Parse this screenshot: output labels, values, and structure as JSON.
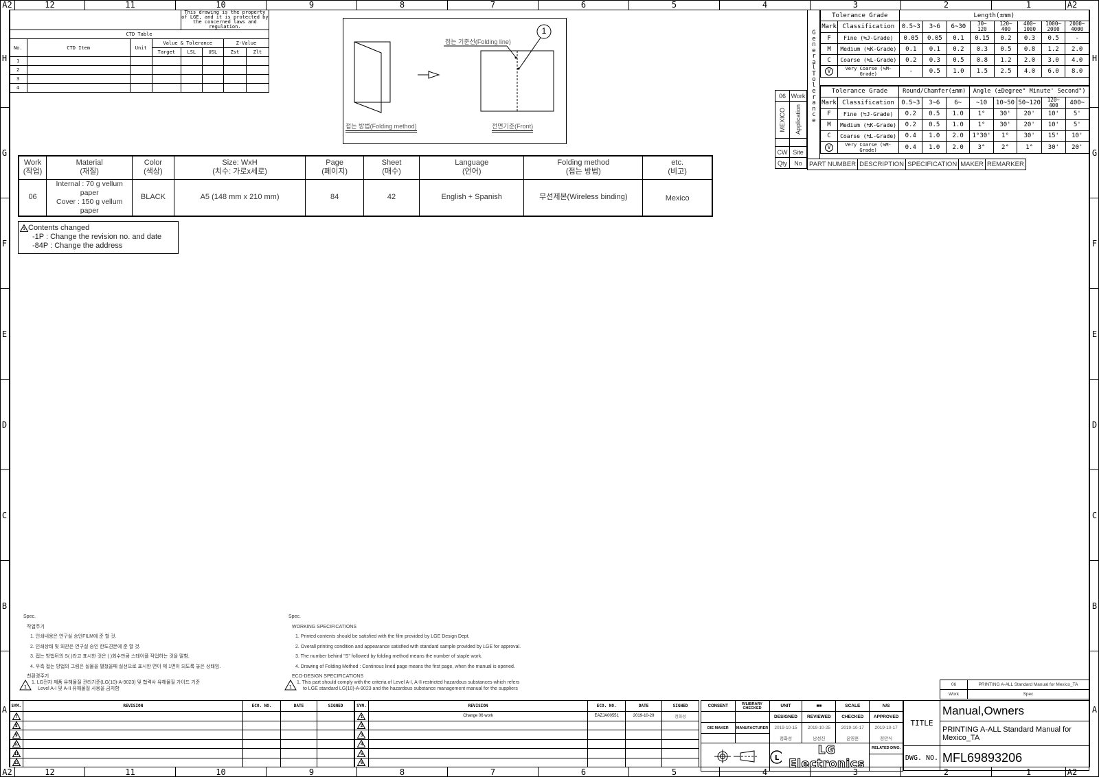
{
  "border": {
    "corner_label": "A2",
    "columns": [
      "12",
      "11",
      "10",
      "9",
      "8",
      "7",
      "6",
      "5",
      "4",
      "3",
      "2",
      "1"
    ],
    "rows": [
      "H",
      "G",
      "F",
      "E",
      "D",
      "C",
      "B",
      "A"
    ]
  },
  "ctd_table": {
    "notice": "This drawing is the property of LGE, and it is protected by the concerned laws and regulation.",
    "title": "CTD Table",
    "headers": {
      "no": "No.",
      "item": "CTD Item",
      "unit": "Unit",
      "value_tolerance": "Value & Tolerance",
      "target": "Target",
      "lsl": "LSL",
      "usl": "USL",
      "z_value": "Z-Value",
      "zst": "Zst",
      "zlt": "Zlt"
    },
    "rows": [
      "1",
      "2",
      "3",
      "4"
    ]
  },
  "folding_diagram": {
    "folding_line_label": "접는 기준선(Folding line)",
    "callout_number": "1",
    "folding_method_caption": "접는 방법(Folding method)",
    "front_caption": "전면기준(Front)"
  },
  "spec_table": {
    "headers": [
      {
        "en": "Work",
        "ko": "(작업)"
      },
      {
        "en": "Material",
        "ko": "(재질)"
      },
      {
        "en": "Color",
        "ko": "(색상)"
      },
      {
        "en": "Size: WxH",
        "ko": "(치수: 가로x세로)"
      },
      {
        "en": "Page",
        "ko": "(페이지)"
      },
      {
        "en": "Sheet",
        "ko": "(매수)"
      },
      {
        "en": "Language",
        "ko": "(언어)"
      },
      {
        "en": "Folding method",
        "ko": "(접는 방법)"
      },
      {
        "en": "etc.",
        "ko": "(비고)"
      }
    ],
    "row": {
      "work": "06",
      "material_line1": "Internal : 70 g vellum paper",
      "material_line2": "Cover : 150 g vellum paper",
      "color": "BLACK",
      "size": "A5 (148 mm x 210 mm)",
      "page": "84",
      "sheet": "42",
      "language": "English + Spanish",
      "folding_method": "무선제본(Wireless binding)",
      "etc": "Mexico"
    }
  },
  "change_note": {
    "revision_symbol": "1",
    "title": "Contents changed",
    "lines": [
      "-1P : Change the revision no. and date",
      "-84P : Change the address"
    ]
  },
  "tolerance": {
    "side_label": "General Tolerance",
    "length_table": {
      "grade_header": "Tolerance Grade",
      "group_header": "Length(±mm)",
      "mark_header": "Mark",
      "class_header": "Classification",
      "ranges": [
        "0.5~3",
        "3~6",
        "6~30",
        "30~ 120",
        "120~ 400",
        "400~ 1000",
        "1000~ 2000",
        "2000~ 4000"
      ],
      "rows": [
        {
          "mark": "F",
          "class": "Fine (≒J-Grade)",
          "values": [
            "0.05",
            "0.05",
            "0.1",
            "0.15",
            "0.2",
            "0.3",
            "0.5",
            "-"
          ]
        },
        {
          "mark": "M",
          "class": "Medium (≒K-Grade)",
          "values": [
            "0.1",
            "0.1",
            "0.2",
            "0.3",
            "0.5",
            "0.8",
            "1.2",
            "2.0"
          ]
        },
        {
          "mark": "C",
          "class": "Coarse (≒L-Grade)",
          "values": [
            "0.2",
            "0.3",
            "0.5",
            "0.8",
            "1.2",
            "2.0",
            "3.0",
            "4.0"
          ]
        },
        {
          "mark": "V",
          "class": "Very Coarse (≒M-Grade)",
          "values": [
            "-",
            "0.5",
            "1.0",
            "1.5",
            "2.5",
            "4.0",
            "6.0",
            "8.0"
          ]
        }
      ]
    },
    "angle_table": {
      "grade_header": "Tolerance Grade",
      "round_header": "Round/Chamfer(±mm)",
      "angle_header": "Angle (±Degree° Minute' Second\")",
      "mark_header": "Mark",
      "class_header": "Classification",
      "ranges": [
        "0.5~3",
        "3~6",
        "6~",
        "~10",
        "10~50",
        "50~120",
        "120~ 400",
        "400~"
      ],
      "rows": [
        {
          "mark": "F",
          "class": "Fine (≒J-Grade)",
          "values": [
            "0.2",
            "0.5",
            "1.0",
            "1°",
            "30'",
            "20'",
            "10'",
            "5'"
          ]
        },
        {
          "mark": "M",
          "class": "Medium (≒K-Grade)",
          "values": [
            "0.2",
            "0.5",
            "1.0",
            "1°",
            "30'",
            "20'",
            "10'",
            "5'"
          ]
        },
        {
          "mark": "C",
          "class": "Coarse (≒L-Grade)",
          "values": [
            "0.4",
            "1.0",
            "2.0",
            "1°30'",
            "1°",
            "30'",
            "15'",
            "10'"
          ]
        },
        {
          "mark": "V",
          "class": "Very Coarse (≒M-Grade)",
          "values": [
            "0.4",
            "1.0",
            "2.0",
            "3°",
            "2°",
            "1°",
            "30'",
            "20'"
          ]
        }
      ]
    }
  },
  "application_block": {
    "work_value": "06",
    "work_label": "Work",
    "site_value": "MEXICO",
    "site_application": "Application",
    "cw_label": "CW",
    "site_label": "Site",
    "qty_label": "Qty",
    "no_label": "No",
    "part_number": "PART NUMBER",
    "description": "DESCRIPTION",
    "specification": "SPECIFICATION",
    "maker": "MAKER",
    "remarker": "REMARKER"
  },
  "notes_ko": {
    "spec": "Spec.",
    "heading": "작업주기",
    "items": [
      "1. 인쇄내용은 연구실 승인FILM에 준 할 것.",
      "2. 인쇄상태 및 외관은 연구실 승인 한도견본에 준 할 것.",
      "3. 접는 방법뒤의 S( )라고 표시한 것은 ( )회수만큼 스테이플 작업하는 것을 말함.",
      "4. 우측 접는 방법의 그림은 실물을 펼쳤을때 실선으로 표시한 면이 제 1면이 되도록  놓은 상태임."
    ],
    "eco_heading": "친환경주기",
    "eco_line1": "1. LG전자 제품 유해물질 관리기준(LG(10)-A-9023) 및 협력사 유해물질 가이드 기준",
    "eco_line2": "Level A-I 및 A-II 유해물질 사용을 금지함"
  },
  "notes_en": {
    "spec": "Spec.",
    "heading": "WORKING SPECIFICATIONS",
    "items": [
      "1. Printed contents should be satisfied with the film provided by LGE Design Dept.",
      "2. Overall printing condition and appearance satisfied with standard sample provided by LGE for approval.",
      "3. The number behind \"S\" followed by folding method means the number of staple work.",
      "4. Drawing of Folding Method : Continous lined page means the first page, when the manual is opened."
    ],
    "eco_heading": "ECO-DESIGN SPECIFICATIONS",
    "eco_line1": "1. This part should comply with the criteria of Level A-I, A-II restricted hazardous substances which refers",
    "eco_line2": "to LGE standard LG(10)-A-9023 and the hazardous substance management manual for the suppliers"
  },
  "revision_left": {
    "headers": {
      "sym": "SYM.",
      "revision": "REVISION",
      "eco": "ECO. NO.",
      "date": "DATE",
      "signed": "SIGNED"
    },
    "rows": [
      {
        "sym": "7",
        "revision": "",
        "eco": "",
        "date": "",
        "signed": ""
      },
      {
        "sym": "8",
        "revision": "",
        "eco": "",
        "date": "",
        "signed": ""
      },
      {
        "sym": "9",
        "revision": "",
        "eco": "",
        "date": "",
        "signed": ""
      },
      {
        "sym": "10",
        "revision": "",
        "eco": "",
        "date": "",
        "signed": ""
      },
      {
        "sym": "11",
        "revision": "",
        "eco": "",
        "date": "",
        "signed": ""
      },
      {
        "sym": "12",
        "revision": "",
        "eco": "",
        "date": "",
        "signed": ""
      }
    ]
  },
  "revision_right": {
    "headers": {
      "sym": "SYM.",
      "revision": "REVISION",
      "eco": "ECO. NO.",
      "date": "DATE",
      "signed": "SIGNED"
    },
    "rows": [
      {
        "sym": "1",
        "revision": "Change 06 work",
        "eco": "EAZJA00551",
        "date": "2019-10-29",
        "signed": "정화성"
      },
      {
        "sym": "2",
        "revision": "",
        "eco": "",
        "date": "",
        "signed": ""
      },
      {
        "sym": "3",
        "revision": "",
        "eco": "",
        "date": "",
        "signed": ""
      },
      {
        "sym": "4",
        "revision": "",
        "eco": "",
        "date": "",
        "signed": ""
      },
      {
        "sym": "5",
        "revision": "",
        "eco": "",
        "date": "",
        "signed": ""
      },
      {
        "sym": "6",
        "revision": "",
        "eco": "",
        "date": "",
        "signed": ""
      }
    ]
  },
  "title_block": {
    "consent": "CONSENT",
    "library_checked": "R/LIBRARY CHECKED",
    "die_maker": "DIE MAKER",
    "manufacturer": "MANUFACTURER",
    "unit_label": "UNIT",
    "unit_value": "■■",
    "scale_label": "SCALE",
    "scale_value": "N/S",
    "designed": "DESIGNED",
    "reviewed": "REVIEWED",
    "checked": "CHECKED",
    "approved": "APPROVED",
    "dates": [
      "2019-10-15",
      "2019-10-25",
      "2019-10-17",
      "2019-10-17"
    ],
    "names": [
      "정화성",
      "남성진",
      "윤영훈",
      "정만식"
    ],
    "related_dwg": "RELATED DWG.",
    "company": "LG Electronics",
    "title_label": "TITLE",
    "title_main": "Manual,Owners",
    "title_sub": "PRINTING A-ALL Standard Manual for Mexico_TA",
    "dwg_no_label": "DWG. NO.",
    "dwg_no": "MFL69893206",
    "work_code": "06",
    "work_spec": "PRINTING A-ALL Standard Manual for Mexico_TA",
    "work_label": "Work",
    "spec_label": "Spec"
  }
}
